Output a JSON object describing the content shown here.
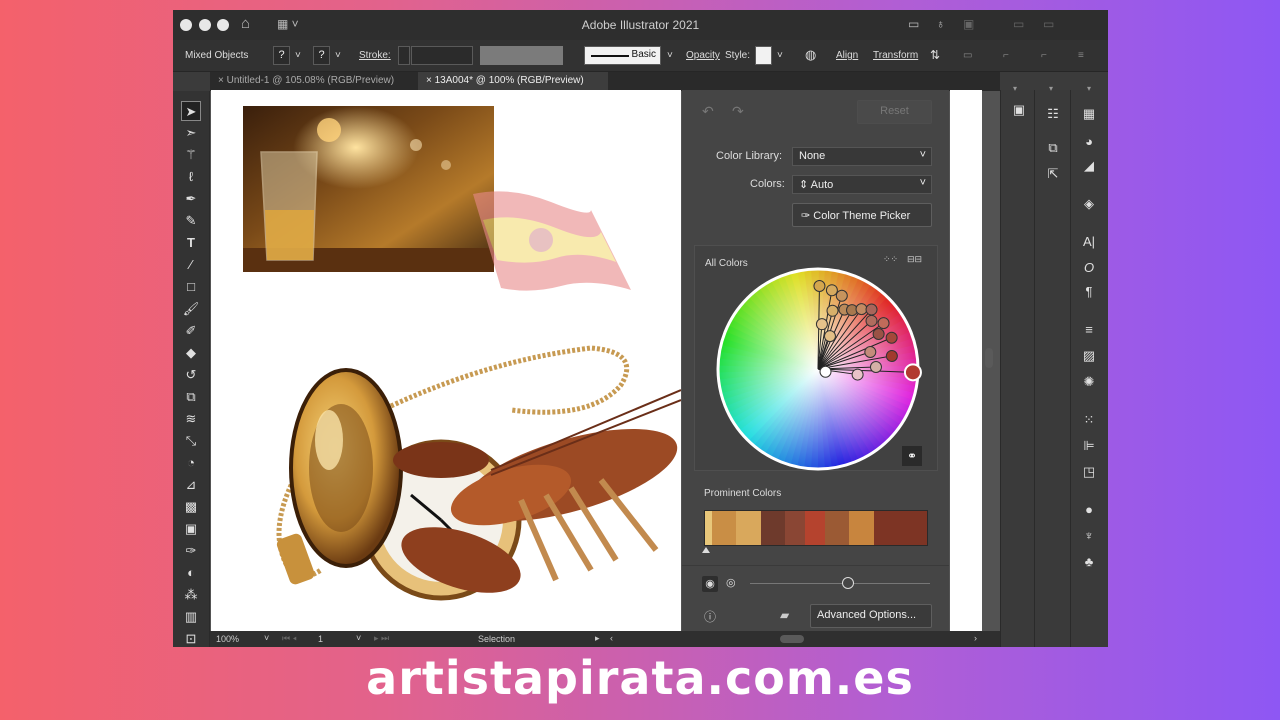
{
  "app": {
    "title": "Adobe Illustrator 2021"
  },
  "control_bar": {
    "selection_type": "Mixed Objects",
    "fill_mark": "?",
    "stroke_mark": "?",
    "stroke_label": "Stroke:",
    "brush_label": "Basic",
    "opacity_label": "Opacity",
    "style_label": "Style:",
    "align_label": "Align",
    "transform_label": "Transform"
  },
  "tabs": [
    {
      "label": "Untitled-1 @ 105.08% (RGB/Preview)",
      "active": false
    },
    {
      "label": "13A004* @ 100% (RGB/Preview)",
      "active": true
    }
  ],
  "tools": [
    "selection-tool-icon",
    "direct-selection-tool-icon",
    "magic-wand-icon",
    "lasso-icon",
    "pen-icon",
    "curvature-icon",
    "type-tool-icon",
    "line-tool-icon",
    "rectangle-tool-icon",
    "paintbrush-icon",
    "shaper-icon",
    "eraser-icon",
    "rotate-icon",
    "scale-icon",
    "warp-icon",
    "free-transform-icon",
    "shape-builder-icon",
    "perspective-grid-icon",
    "mesh-icon",
    "gradient-icon",
    "eyedropper-icon",
    "blend-icon",
    "symbol-sprayer-icon",
    "graph-icon",
    "artboard-tool-icon"
  ],
  "recolor_panel": {
    "reset_label": "Reset",
    "color_library_label": "Color Library:",
    "color_library_value": "None",
    "colors_label": "Colors:",
    "colors_value": "Auto",
    "theme_picker_label": "Color Theme Picker",
    "all_colors_label": "All Colors",
    "prominent_colors_label": "Prominent Colors",
    "advanced_options_label": "Advanced Options...",
    "prominent_colors": [
      {
        "color": "#e8c77a",
        "share": 0.03
      },
      {
        "color": "#c98e45",
        "share": 0.11
      },
      {
        "color": "#d9a85c",
        "share": 0.11
      },
      {
        "color": "#6e3a2c",
        "share": 0.11
      },
      {
        "color": "#8a4634",
        "share": 0.09
      },
      {
        "color": "#b5432e",
        "share": 0.09
      },
      {
        "color": "#9b5a34",
        "share": 0.11
      },
      {
        "color": "#c8853e",
        "share": 0.11
      },
      {
        "color": "#7d3424",
        "share": 0.24
      }
    ],
    "wheel_handles": [
      {
        "angle": 1,
        "r": 0.83,
        "color": "#d4a74e"
      },
      {
        "angle": 10,
        "r": 0.8,
        "color": "#d6aa5f"
      },
      {
        "angle": 18,
        "r": 0.77,
        "color": "#c7945d"
      },
      {
        "angle": 14,
        "r": 0.6,
        "color": "#d8b06a"
      },
      {
        "angle": 24,
        "r": 0.65,
        "color": "#b98a5a"
      },
      {
        "angle": 30,
        "r": 0.68,
        "color": "#a7784e"
      },
      {
        "angle": 36,
        "r": 0.74,
        "color": "#c28a62"
      },
      {
        "angle": 42,
        "r": 0.8,
        "color": "#a9655a"
      },
      {
        "angle": 48,
        "r": 0.72,
        "color": "#b06c5e"
      },
      {
        "angle": 55,
        "r": 0.8,
        "color": "#c06b5a"
      },
      {
        "angle": 60,
        "r": 0.7,
        "color": "#9a5245"
      },
      {
        "angle": 67,
        "r": 0.8,
        "color": "#a4483a"
      },
      {
        "angle": 72,
        "r": 0.55,
        "color": "#c48b7a"
      },
      {
        "angle": 80,
        "r": 0.75,
        "color": "#a23a2e"
      },
      {
        "angle": 88,
        "r": 0.58,
        "color": "#d5b0a6"
      },
      {
        "angle": 92,
        "r": 0.95,
        "color": "#b23a30"
      },
      {
        "angle": 98,
        "r": 0.4,
        "color": "#e8c3c8"
      },
      {
        "angle": 110,
        "r": 0.08,
        "color": "#ffffff"
      },
      {
        "angle": 5,
        "r": 0.45,
        "color": "#e6c28a"
      },
      {
        "angle": 20,
        "r": 0.35,
        "color": "#e3bf86"
      }
    ],
    "base_color_index": 15
  },
  "status_bar": {
    "zoom": "100%",
    "artboard": "1",
    "mode": "Selection"
  },
  "watermark": "artistapirata.com.es"
}
